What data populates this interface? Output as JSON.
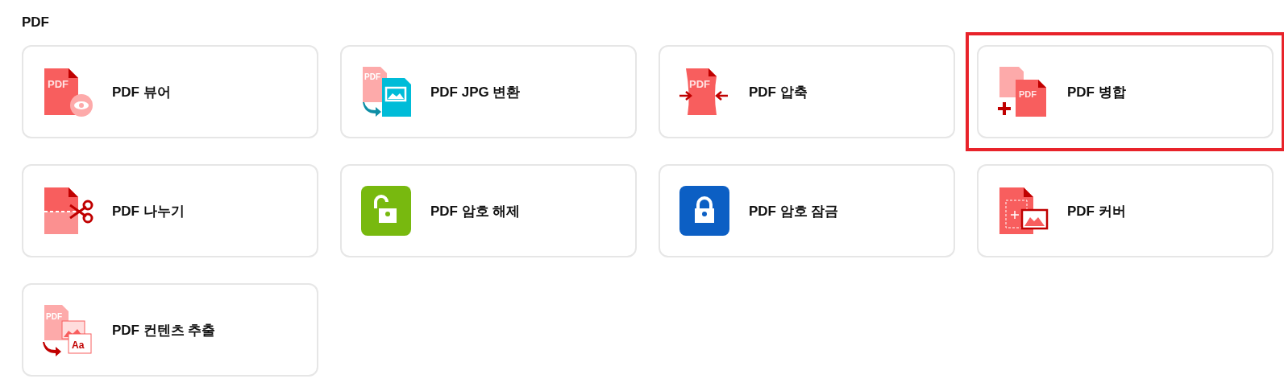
{
  "section": {
    "title": "PDF"
  },
  "tools": [
    {
      "kind": "viewer",
      "label": "PDF 뷰어",
      "icon_text": "PDF",
      "highlighted": false
    },
    {
      "kind": "jpg",
      "label": "PDF JPG 변환",
      "icon_text": "PDF",
      "highlighted": false
    },
    {
      "kind": "compress",
      "label": "PDF 압축",
      "icon_text": "PDF",
      "highlighted": false
    },
    {
      "kind": "merge",
      "label": "PDF 병합",
      "icon_text": "PDF",
      "highlighted": true
    },
    {
      "kind": "split",
      "label": "PDF 나누기",
      "highlighted": false
    },
    {
      "kind": "unlock",
      "label": "PDF 암호 해제",
      "highlighted": false
    },
    {
      "kind": "lock",
      "label": "PDF 암호 잠금",
      "highlighted": false
    },
    {
      "kind": "cover",
      "label": "PDF 커버",
      "highlighted": false
    },
    {
      "kind": "extract",
      "label": "PDF 컨텐츠 추출",
      "icon_text": "PDF",
      "icon_text_2": "Aa",
      "highlighted": false
    }
  ]
}
